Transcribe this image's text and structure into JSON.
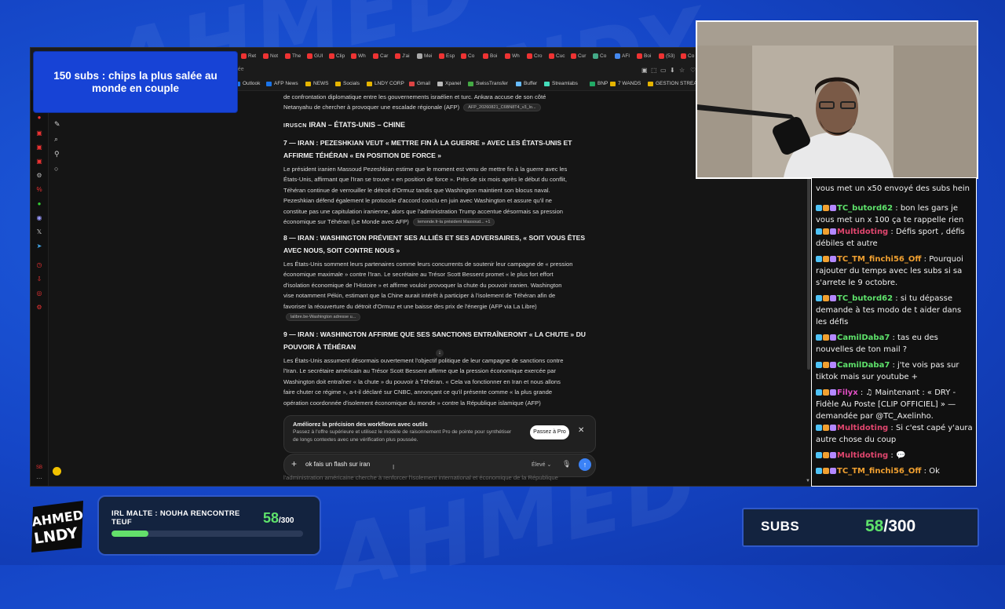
{
  "background": {
    "color": "#1546c7",
    "watermark_texts": [
      "AHMED",
      "LNDY"
    ]
  },
  "subs_banner": {
    "text": "150 subs : chips la plus salée au monde en couple"
  },
  "browser": {
    "tabs": [
      "Ret",
      "Not",
      "The",
      "GUI",
      "Clip",
      "Wh",
      "Car",
      "J'ai",
      "Mei",
      "Esp",
      "Co",
      "Boi",
      "Wh",
      "Cro",
      "Cuc",
      "Cur",
      "Co",
      "AFI",
      "Boi",
      "(53)",
      "Co"
    ],
    "url_text": "hée",
    "bookmarks": [
      "Outlook",
      "AFP News",
      "NEWS",
      "Socials",
      "LNDY CORP",
      "Gmail",
      "Xpanel",
      "SwissTransfer",
      "Buffer",
      "Streamlabs",
      "BNP",
      "7 WANDS",
      "GESTION STREAM"
    ],
    "article": {
      "intro_lines": [
        "de confrontation diplomatique entre les gouvernements israélien et turc. Ankara accuse de son côté",
        "Netanyahu de chercher à provoquer une escalade régionale (AFP)"
      ],
      "intro_chip": "AFP_20260821_C6BN8T4_v3_lo...",
      "section_tag": "IRUSCN",
      "section_title": "IRAN – ÉTATS-UNIS – CHINE",
      "items": [
        {
          "title_1": "7 — IRAN : PEZESHKIAN VEUT « METTRE FIN À LA GUERRE » AVEC LES ÉTATS-UNIS ET",
          "title_2": "AFFIRME TÉHÉRAN « EN POSITION DE FORCE »",
          "lines": [
            "Le président iranien Massoud Pezeshkian estime que le moment est venu de mettre fin à la guerre avec les",
            "États-Unis, affirmant que l'Iran se trouve « en position de force ». Près de six mois après le début du conflit,",
            "Téhéran continue de verrouiller le détroit d'Ormuz tandis que Washington maintient son blocus naval.",
            "Pezeshkian défend également le protocole d'accord conclu en juin avec Washington et assure qu'il ne",
            "constitue pas une capitulation iranienne, alors que l'administration Trump accentue désormais sa pression",
            "économique sur Téhéran (Le Monde avec AFP)"
          ],
          "chip": "lemonde.fr-la président Massoud... +1"
        },
        {
          "title_1": "8 — IRAN : WASHINGTON PRÉVIENT SES ALLIÉS ET SES ADVERSAIRES, « SOIT VOUS ÊTES",
          "title_2": "AVEC NOUS, SOIT CONTRE NOUS »",
          "lines": [
            "Les États-Unis somment leurs partenaires comme leurs concurrents de soutenir leur campagne de « pression",
            "économique maximale » contre l'Iran. Le secrétaire au Trésor Scott Bessent promet « le plus fort effort",
            "d'isolation économique de l'Histoire » et affirme vouloir provoquer la chute du pouvoir iranien. Washington",
            "vise notamment Pékin, estimant que la Chine aurait intérêt à participer à l'isolement de Téhéran afin de",
            "favoriser la réouverture du détroit d'Ormuz et une baisse des prix de l'énergie (AFP via La Libre)"
          ],
          "chip": "lalibre.be-Washington adresse u..."
        },
        {
          "title_1": "9 — IRAN : WASHINGTON AFFIRME QUE SES SANCTIONS ENTRAÎNERONT « LA CHUTE » DU",
          "title_2": "POUVOIR À TÉHÉRAN",
          "lines": [
            "Les États-Unis assument désormais ouvertement l'objectif politique de leur campagne de sanctions contre",
            "l'Iran. Le secrétaire américain au Trésor Scott Bessent affirme que la pression économique exercée par",
            "Washington doit entraîner « la chute » du pouvoir à Téhéran. « Cela va fonctionner en Iran et nous allons",
            "faire chuter ce régime », a-t-il déclaré sur CNBC, annonçant ce qu'il présente comme « la plus grande",
            "opération coordonnée d'isolement économique du monde » contre la République islamique (AFP)"
          ]
        }
      ]
    },
    "upsell": {
      "title": "Améliorez la précision des workflows avec outils",
      "body": "Passez à l'offre supérieure et utilisez le modèle de raisonnement Pro de pointe pour synthétiser de longs contextes avec une vérification plus poussée.",
      "button": "Passez à Pro",
      "close": "✕"
    },
    "prompt": {
      "value": "ok fais un flash sur iran",
      "model": "Élevé ⌄",
      "send": "↑"
    },
    "below_text": "l'administration américaine cherche à renforcer l'isolement international et économique de la République"
  },
  "chat": [
    {
      "user": "",
      "text": "vous met un x50 envoyé des subs hein",
      "color": "#f1f1f1"
    },
    {
      "user": "TC_butord62",
      "text": " : bon les gars je vous met un x 100 ça te rappelle rien",
      "color": "#5ee26b"
    },
    {
      "user": "Multidoting",
      "text": " : Défis sport , défis débiles et autre",
      "color": "#e0466e"
    },
    {
      "user": "TC_TM_finchi56_Off",
      "text": " : Pourquoi rajouter du temps avec les subs si sa s'arrete le 9 octobre.",
      "color": "#f0a030"
    },
    {
      "user": "TC_butord62",
      "text": " : si tu dépasse demande à tes modo de t aider dans les défis",
      "color": "#5ee26b"
    },
    {
      "user": "CamilDaba7",
      "text": " : tas eu des nouvelles de ton mail ?",
      "color": "#5ee26b"
    },
    {
      "user": "CamilDaba7",
      "text": " : j'te vois pas sur tiktok mais sur youtube +",
      "color": "#5ee26b"
    },
    {
      "user": "Filyx",
      "text": " : ♫ Maintenant : « DRY - Fidèle Au Poste [CLIP OFFICIEL] » — demandée par @TC_Axelinho.",
      "color": "#e24fc4"
    },
    {
      "user": "Multidoting",
      "text": " : Si c'est capé y'aura autre chose du coup",
      "color": "#e0466e"
    },
    {
      "user": "Multidoting",
      "text": " : 💬",
      "color": "#e0466e"
    },
    {
      "user": "TC_TM_finchi56_Off",
      "text": " : Ok",
      "color": "#f0a030"
    }
  ],
  "irl_goal": {
    "title": "IRL MALTE : NOUHA RENCONTRE TEUF",
    "current": "58",
    "total": "/300",
    "progress": 0.193
  },
  "subs_goal": {
    "label": "SUBS",
    "current": "58",
    "total": "/300"
  },
  "logo": {
    "line1": "AHMED",
    "line2": "LNDY"
  }
}
